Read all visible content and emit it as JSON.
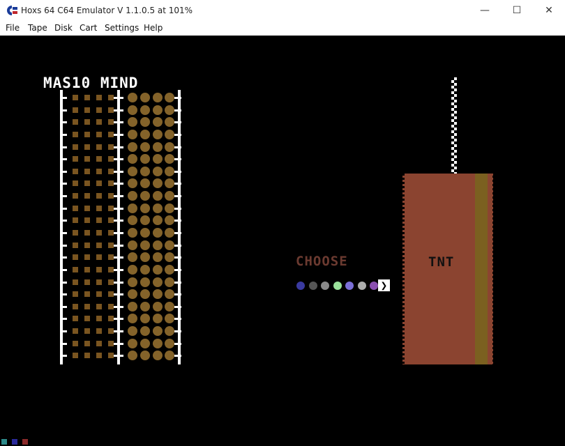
{
  "window": {
    "title": "Hoxs 64 C64 Emulator    V 1.1.0.5 at 101%",
    "minimize_glyph": "—",
    "maximize_glyph": "☐",
    "close_glyph": "✕"
  },
  "menu": [
    {
      "label": "File"
    },
    {
      "label": "Tape"
    },
    {
      "label": "Disk"
    },
    {
      "label": "Cart"
    },
    {
      "label": "Settings"
    },
    {
      "label": "Help"
    }
  ],
  "game": {
    "title": "MAS10 MIND",
    "choose_label": "CHOOSE",
    "tnt_label": "TNT",
    "arrow_glyph": "❯",
    "palette_colors": [
      "#3a3aa0",
      "#555555",
      "#8a8a8a",
      "#9ae29b",
      "#7b6fd8",
      "#adadad",
      "#8a4fb0"
    ],
    "rows": 22,
    "colors": {
      "background": "#000000",
      "choose": "#6b3a30",
      "tnt_box": "#8b4430",
      "tnt_stripe": "#7b6020",
      "peg": "#84632a",
      "hint": "#7a5520"
    }
  },
  "status": {
    "led_colors": [
      "#2d8a8a",
      "#2a2a9a",
      "#8a2a2a"
    ]
  },
  "icons": {
    "app": "commodore-logo-icon"
  }
}
